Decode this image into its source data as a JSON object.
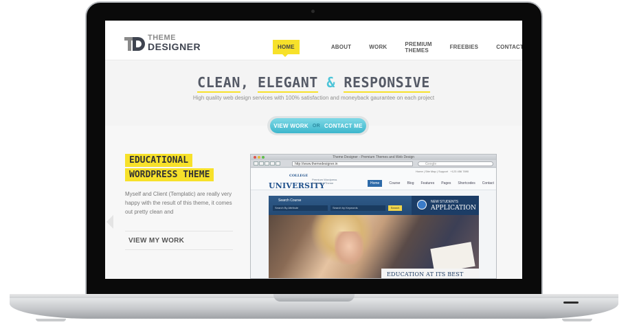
{
  "site": {
    "logo": {
      "line1": "THEME",
      "line2": "DESIGNER"
    },
    "nav": [
      "HOME",
      "ABOUT",
      "WORK",
      "PREMIUM THEMES",
      "FREEBIES",
      "CONTACT"
    ],
    "hero": {
      "title_word1": "CLEAN",
      "title_sep1": ", ",
      "title_word2": "ELEGANT",
      "title_amp": " & ",
      "title_word3": "RESPONSIVE",
      "subtitle": "High quality web design services with 100% satisfaction and moneyback gaurantee on each project"
    },
    "cta": {
      "view": "VIEW WORK",
      "or": "OR",
      "contact": "CONTACT ME"
    },
    "feature": {
      "title_line1": "EDUCATIONAL",
      "title_line2": "WORDPRESS THEME",
      "description": "Myself and Client (Templatic) are really very happy with the result of this theme, it comes out pretty clean and",
      "link": "VIEW MY WORK"
    }
  },
  "browser": {
    "window_title": "Theme Designer - Premium Themes and Web Design",
    "url": "http://www.themedesigner.in",
    "search_placeholder": "Google",
    "inner": {
      "top_links": "Home | Site Map | Support",
      "phone": "+123 456 7890",
      "logo_small": "COLLEGE",
      "logo_big": "UNIVERSITY",
      "tagline": "Premium Wordpress Education Theme",
      "nav": [
        "Home",
        "Course",
        "Blog",
        "Features",
        "Pages",
        "Shortcodes",
        "Contact"
      ],
      "search_label": "Search Course",
      "search_select": "Search By Attribute",
      "search_keywords": "Search by Keywords",
      "search_button": "Search",
      "app_line1": "NEW STUDENTS",
      "app_line2": "APPLICATION",
      "caption": "EDUCATION AT ITS BEST"
    }
  },
  "colors": {
    "accent_yellow": "#f7e12a",
    "accent_cyan": "#4cc4d8",
    "inner_blue": "#2c4f78"
  }
}
